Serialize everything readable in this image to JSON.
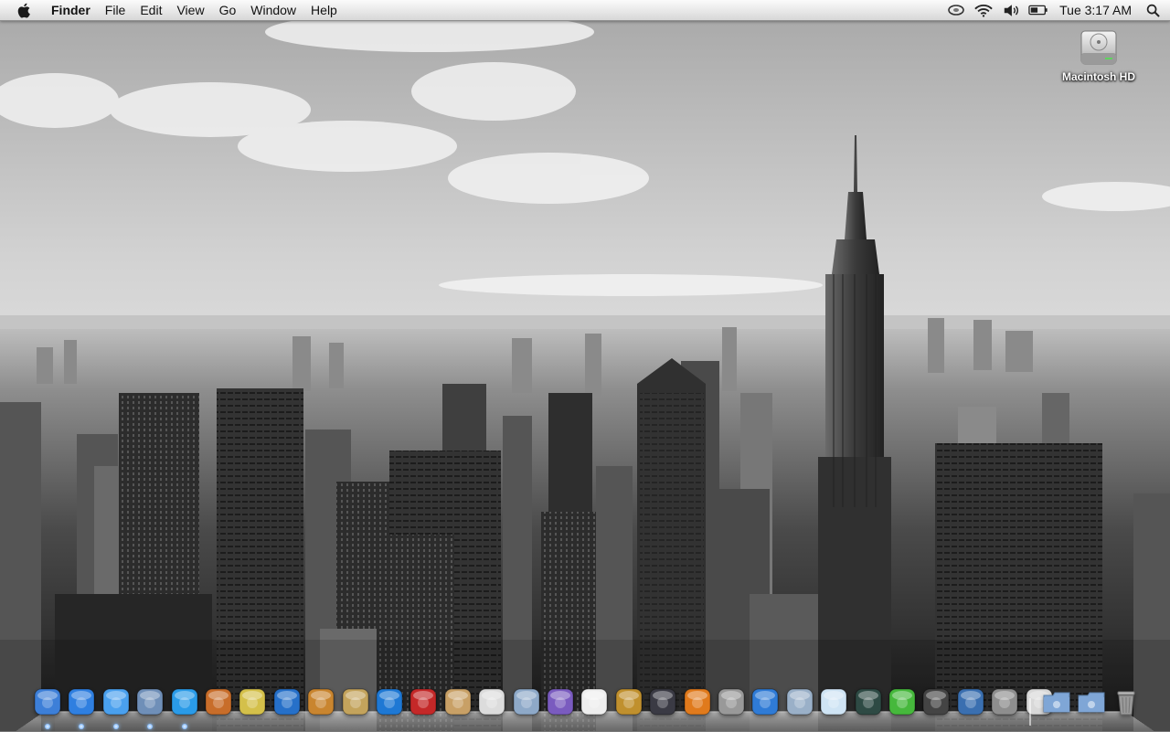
{
  "menubar": {
    "apple_icon": "apple-icon",
    "app_name": "Finder",
    "menus": [
      "File",
      "Edit",
      "View",
      "Go",
      "Window",
      "Help"
    ],
    "status_icons": [
      "sync-icon",
      "wifi-icon",
      "volume-icon",
      "battery-icon"
    ],
    "clock": "Tue 3:17 AM",
    "spotlight_icon": "spotlight-icon"
  },
  "desktop": {
    "icons": [
      {
        "label": "Macintosh HD",
        "icon": "hard-drive-icon"
      }
    ]
  },
  "dock": {
    "apps": [
      {
        "name": "finder-icon",
        "color": "#3d7fd8"
      },
      {
        "name": "safari-icon",
        "color": "#2f7fe0"
      },
      {
        "name": "ichat-icon",
        "color": "#4aa0ee"
      },
      {
        "name": "mail-icon",
        "color": "#6f8fb8"
      },
      {
        "name": "itunes-icon",
        "color": "#2a9be8"
      },
      {
        "name": "iphoto-icon",
        "color": "#c86d2a"
      },
      {
        "name": "aperture-icon",
        "color": "#d4c04a"
      },
      {
        "name": "dvd-player-icon",
        "color": "#2670c9"
      },
      {
        "name": "garageband-icon",
        "color": "#c9852f"
      },
      {
        "name": "preview-icon",
        "color": "#c3a35c"
      },
      {
        "name": "quicktime-icon",
        "color": "#1e78d4"
      },
      {
        "name": "photo-booth-icon",
        "color": "#c42828"
      },
      {
        "name": "address-book-icon",
        "color": "#c8a066"
      },
      {
        "name": "textedit-icon",
        "color": "#dcdcdc"
      },
      {
        "name": "image-capture-icon",
        "color": "#8ea9c8"
      },
      {
        "name": "front-row-icon",
        "color": "#7a5bbf"
      },
      {
        "name": "coffee-mug-icon",
        "color": "#eeeeee"
      },
      {
        "name": "iweb-icon",
        "color": "#c0902e"
      },
      {
        "name": "dashboard-icon",
        "color": "#3a3a44"
      },
      {
        "name": "umbrella-icon",
        "color": "#e07a1c"
      },
      {
        "name": "camera-icon",
        "color": "#999999"
      },
      {
        "name": "google-earth-icon",
        "color": "#2f7bd6"
      },
      {
        "name": "utilities-icon",
        "color": "#9ab0c8"
      },
      {
        "name": "monitor-icon",
        "color": "#cfe4f4"
      },
      {
        "name": "activity-monitor-icon",
        "color": "#2e4a44"
      },
      {
        "name": "transmit-icon",
        "color": "#46b83c"
      },
      {
        "name": "safety-icon",
        "color": "#444444"
      },
      {
        "name": "spaces-icon",
        "color": "#3a6fb0"
      },
      {
        "name": "system-preferences-icon",
        "color": "#8e8e8e"
      },
      {
        "name": "spray-can-icon",
        "color": "#d8d8d8"
      }
    ],
    "folders": [
      {
        "name": "applications-folder-icon",
        "color": "#7fa6d6"
      },
      {
        "name": "downloads-folder-icon",
        "color": "#7fa6d6"
      }
    ],
    "trash": {
      "name": "trash-icon",
      "color": "#9a9a9a"
    }
  }
}
